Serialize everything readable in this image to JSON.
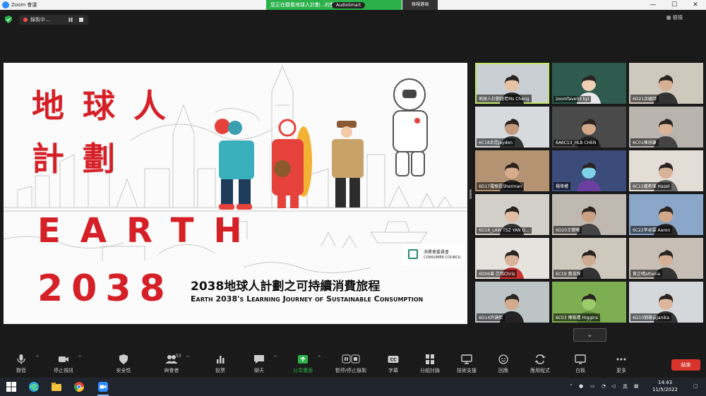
{
  "window": {
    "title": "Zoom 會議",
    "share_banner": "您正在觀看地球人計劃…的螢幕",
    "audio_badge": "AudioSmart",
    "view_options": "檢視選項",
    "minimize": "—",
    "maximize": "☐",
    "close": "✕"
  },
  "meeting": {
    "recording_label": "錄製中…",
    "gallery_view_label": "檢視"
  },
  "slide": {
    "title_zh_line1": "地球人",
    "title_zh_line2": "計劃",
    "title_en": "EARTH",
    "year": "2038",
    "subtitle_zh": "2038地球人計劃之可持續消費旅程",
    "subtitle_en": "Earth 2038's Learning Journey of Sustainable Consumption",
    "logo_zh": "消費者委員會",
    "logo_en": "CONSUMER COUNCIL"
  },
  "participants": [
    {
      "name": "地球人計劃趙老Ms Cheng",
      "bg": "#c9cfd2",
      "skin": "#e9c3a6",
      "shirt": "#2d2d2d",
      "active": true
    },
    {
      "name": "zoomfave03 kyi",
      "bg": "#2f5b4f",
      "skin": "#f0cfb6",
      "shirt": "#e8e8e8",
      "active": false
    },
    {
      "name": "6D21余穎詩",
      "bg": "#cfc8bc",
      "skin": "#d7b094",
      "shirt": "#333",
      "active": false
    },
    {
      "name": "6C18余昆Jayden",
      "bg": "#d7d9dc",
      "skin": "#c49a7e",
      "shirt": "#333",
      "active": false
    },
    {
      "name": "6A6C13_HLB CHEN",
      "bg": "#4a4a4a",
      "skin": "#d3a989",
      "shirt": "#222",
      "active": false
    },
    {
      "name": "6C01陳璟謙",
      "bg": "#b8b3ad",
      "skin": "#dbb498",
      "shirt": "#444",
      "active": false
    },
    {
      "name": "6D17羅駿霆Sherman",
      "bg": "#b49373",
      "skin": "#d8ad8e",
      "shirt": "#2b2b2b",
      "active": false
    },
    {
      "name": "楊偉權",
      "bg": "#3b4b7a",
      "skin": "#7dd1e8",
      "shirt": "#6b3fa0",
      "active": false
    },
    {
      "name": "6C11鍾希瑤 Hazel",
      "bg": "#e3ddd6",
      "skin": "#d8b39a",
      "shirt": "#666",
      "active": false
    },
    {
      "name": "6D18_LAW TSZ YAN G…",
      "bg": "#d2cec8",
      "skin": "#e1bea4",
      "shirt": "#333",
      "active": false
    },
    {
      "name": "6D20王懷曦",
      "bg": "#bfb9b1",
      "skin": "#caa084",
      "shirt": "#444",
      "active": false
    },
    {
      "name": "6C22李卓霖 Aaron",
      "bg": "#8aa6c8",
      "skin": "#d0a788",
      "shirt": "#2b2b2b",
      "active": false
    },
    {
      "name": "6D06曾 芯恬Chris",
      "bg": "#e6e2dd",
      "skin": "#d9b299",
      "shirt": "#c33",
      "active": false
    },
    {
      "name": "6C19 黃浩琛",
      "bg": "#cfc8bd",
      "skin": "#ccab90",
      "shirt": "#333",
      "active": false
    },
    {
      "name": "黃芷晴athena",
      "bg": "#c7beb5",
      "skin": "#d6af94",
      "shirt": "#333",
      "active": false
    },
    {
      "name": "6D14許灝熙",
      "bg": "#bcc4c5",
      "skin": "#d3aa8d",
      "shirt": "#222",
      "active": false
    },
    {
      "name": "6C03 陳皓禮 Higgins",
      "bg": "#7eae52",
      "skin": "#9ccc6a",
      "shirt": "#5a8a3a",
      "active": false
    },
    {
      "name": "6D10劉樂云Janika",
      "bg": "#d4d8db",
      "skin": "#dcb69c",
      "shirt": "#333",
      "active": false
    }
  ],
  "scroll_down": "⌄",
  "toolbar": {
    "mute": "靜音",
    "stop_video": "停止視訊",
    "security": "安全性",
    "participants": "與會者",
    "participants_count": "53",
    "polls": "投票",
    "chat": "聊天",
    "share_screen": "分享畫面",
    "pause_recording": "暫停/停止錄製",
    "captions": "字幕",
    "breakout": "分組討論",
    "remote_support": "技術支援",
    "reactions": "回應",
    "apps": "應用程式",
    "whiteboard": "白板",
    "more": "更多",
    "end": "結束"
  },
  "taskbar": {
    "input_method": "英",
    "time": "14:43",
    "date": "11/5/2022"
  },
  "colors": {
    "slide_red": "#d62027",
    "zoom_green": "#2bb14a",
    "end_red": "#d9342b",
    "active_speaker": "#c3e66a"
  }
}
